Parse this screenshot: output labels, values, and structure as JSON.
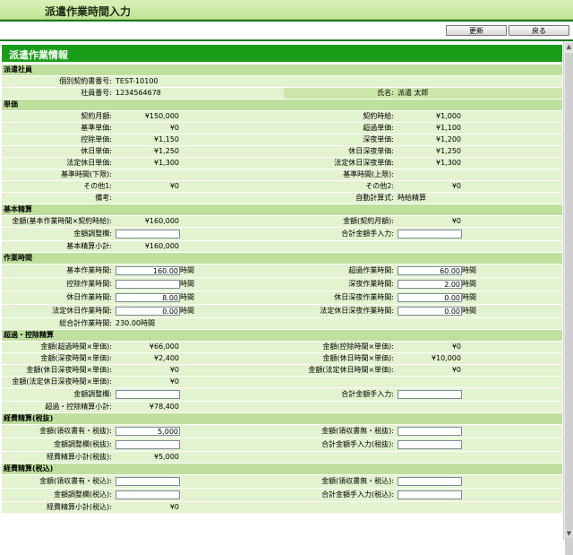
{
  "header": {
    "title": "派遣作業時間入力",
    "update_button": "更新",
    "back_button": "戻る"
  },
  "section_title": "派遣作業情報",
  "worker": {
    "heading": "派遣社員",
    "contract_no_label": "個別契約書番号:",
    "contract_no": "TEST-10100",
    "employee_no_label": "社員番号:",
    "employee_no": "1234564678",
    "name_label": "氏名:",
    "name": "派遣 太郎"
  },
  "unit_price": {
    "heading": "単価",
    "rows": [
      {
        "l_label": "契約月額:",
        "l_val": "¥150,000",
        "r_label": "契約時給:",
        "r_val": "¥1,000"
      },
      {
        "l_label": "基準単価:",
        "l_val": "¥0",
        "r_label": "超過単価:",
        "r_val": "¥1,100"
      },
      {
        "l_label": "控除単価:",
        "l_val": "¥1,150",
        "r_label": "深夜単価:",
        "r_val": "¥1,200"
      },
      {
        "l_label": "休日単価:",
        "l_val": "¥1,250",
        "r_label": "休日深夜単価:",
        "r_val": "¥1,250"
      },
      {
        "l_label": "法定休日単価:",
        "l_val": "¥1,300",
        "r_label": "法定休日深夜単価:",
        "r_val": "¥1,300"
      },
      {
        "l_label": "基準時間(下限):",
        "l_val": "",
        "r_label": "基準時間(上限):",
        "r_val": ""
      },
      {
        "l_label": "その他1:",
        "l_val": "¥0",
        "r_label": "その他2:",
        "r_val": "¥0"
      },
      {
        "l_label": "備考:",
        "l_val": "",
        "r_label": "自動計算式:",
        "r_val": "時給精算"
      }
    ]
  },
  "base_calc": {
    "heading": "基本精算",
    "amount_label": "金額(基本作業時間×契約時給):",
    "amount": "¥160,000",
    "monthly_label": "金額(契約月額):",
    "monthly": "¥0",
    "adjust_label": "金額調整欄:",
    "adjust": "",
    "total_manual_label": "合計金額手入力:",
    "total_manual": "",
    "subtotal_label": "基本精算小計:",
    "subtotal": "¥160,000"
  },
  "work_time": {
    "heading": "作業時間",
    "unit": "時間",
    "rows": [
      {
        "l_label": "基本作業時間:",
        "l_val": "160.00",
        "r_label": "超過作業時間:",
        "r_val": "60.00"
      },
      {
        "l_label": "控除作業時間:",
        "l_val": "",
        "r_label": "深夜作業時間:",
        "r_val": "2.00"
      },
      {
        "l_label": "休日作業時間:",
        "l_val": "8.00",
        "r_label": "休日深夜作業時間:",
        "r_val": "0.00"
      },
      {
        "l_label": "法定休日作業時間:",
        "l_val": "0.00",
        "r_label": "法定休日深夜作業時間:",
        "r_val": "0.00"
      }
    ],
    "total_label": "総合計作業時間:",
    "total": "230.00時間"
  },
  "overtime": {
    "heading": "超過・控除精算",
    "rows": [
      {
        "l_label": "金額(超過時間×単価):",
        "l_val": "¥66,000",
        "r_label": "金額(控除時間×単価):",
        "r_val": "¥0"
      },
      {
        "l_label": "金額(深夜時間×単価):",
        "l_val": "¥2,400",
        "r_label": "金額(休日時間×単価):",
        "r_val": "¥10,000"
      },
      {
        "l_label": "金額(休日深夜時間×単価):",
        "l_val": "¥0",
        "r_label": "金額(法定休日時間×単価):",
        "r_val": "¥0"
      },
      {
        "l_label": "金額(法定休日深夜時間×単価):",
        "l_val": "¥0",
        "r_label": "",
        "r_val": ""
      }
    ],
    "adjust_label": "金額調整欄:",
    "total_manual_label": "合計金額手入力:",
    "subtotal_label": "超過・控除精算小計:",
    "subtotal": "¥78,400"
  },
  "expense_taxfree": {
    "heading": "経費精算(税抜)",
    "receipt_label": "金額(領収書有・税抜):",
    "receipt": "5,000",
    "no_receipt_label": "金額(領収書無・税抜):",
    "no_receipt": "",
    "adjust_label": "金額調整欄(税抜):",
    "adjust": "",
    "total_manual_label": "合計金額手入力(税抜):",
    "total_manual": "",
    "subtotal_label": "経費精算小計(税抜):",
    "subtotal": "¥5,000"
  },
  "expense_taxin": {
    "heading": "経費精算(税込)",
    "receipt_label": "金額(領収書有・税込):",
    "receipt": "",
    "no_receipt_label": "金額(領収書無・税込):",
    "no_receipt": "",
    "adjust_label": "金額調整欄(税込):",
    "adjust": "",
    "total_manual_label": "合計金額手入力(税込):",
    "total_manual": "",
    "subtotal_label": "経費精算小計(税込):",
    "subtotal": "¥0"
  }
}
